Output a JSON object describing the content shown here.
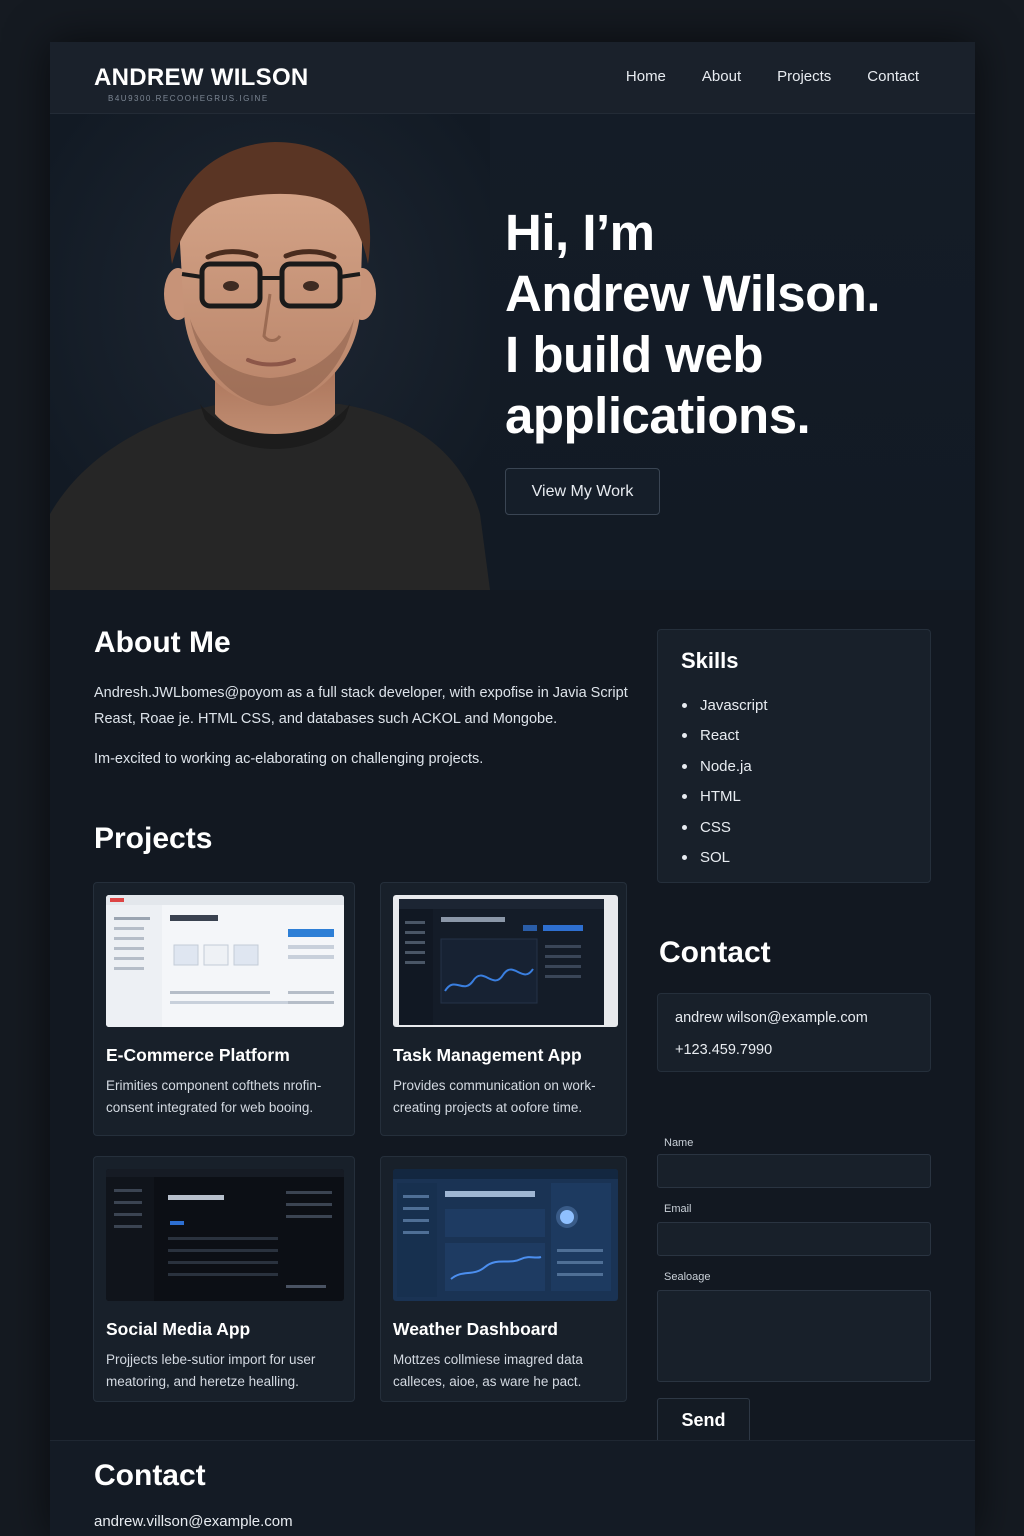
{
  "header": {
    "brand": "ANDREW WILSON",
    "brand_sub": "B4U9300.RECOOHEGRUS.IGINE",
    "nav": [
      "Home",
      "About",
      "Projects",
      "Contact"
    ]
  },
  "hero": {
    "heading_lines": [
      "Hi, I’m",
      "Andrew Wilson.",
      "I build web",
      "applications."
    ],
    "cta": "View My Work"
  },
  "about": {
    "title": "About Me",
    "paragraph1": "Andresh.JWLbomes@poyom as a full stack developer, with expofise in Javia Script  Reast, Roae je. HTML CSS, and databases such ACKOL and Mongobe.",
    "paragraph2": "Im-excited to working ac-elaborating on challenging projects."
  },
  "projects": {
    "title": "Projects",
    "items": [
      {
        "title": "E-Commerce Platform",
        "desc": "Erimities component cofthets nrofin-consent integrated for web booing."
      },
      {
        "title": "Task Management App",
        "desc": "Provides communication on work-creating projects at oofore time."
      },
      {
        "title": "Social Media App",
        "desc": "Projjects lebe-sutior import for user meatoring, and heretze healling."
      },
      {
        "title": "Weather Dashboard",
        "desc": "Mottzes collmiese imagred data calleces, aioe, as ware he pact."
      }
    ]
  },
  "skills": {
    "title": "Skills",
    "items": [
      "Javascript",
      "React",
      "Node.ja",
      "HTML",
      "CSS",
      "SOL"
    ]
  },
  "contact": {
    "title": "Contact",
    "email": "andrew wilson@example.com",
    "phone": "+123.459.7990",
    "name_label": "Name",
    "email_label": "Email",
    "message_label": "Sealoage",
    "send": "Send"
  },
  "footer": {
    "title": "Contact",
    "email": "andrew.villson@example.com"
  },
  "colors": {
    "background": "#151a21",
    "panel": "#18202a",
    "text": "#e8ecf1"
  }
}
